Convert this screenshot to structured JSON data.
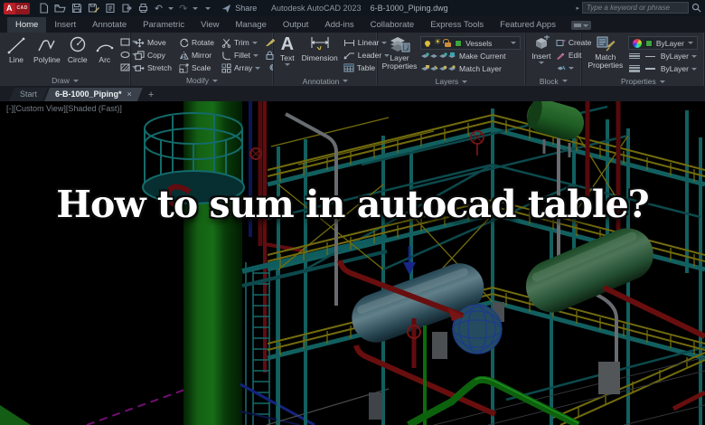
{
  "titlebar": {
    "logo_a": "A",
    "logo_cad": "CAD",
    "share_label": "Share",
    "app_title": "Autodesk AutoCAD 2023",
    "doc_title": "6-B-1000_Piping.dwg",
    "search_placeholder": "Type a keyword or phrase"
  },
  "ribbon_tabs": [
    "Home",
    "Insert",
    "Annotate",
    "Parametric",
    "View",
    "Manage",
    "Output",
    "Add-ins",
    "Collaborate",
    "Express Tools",
    "Featured Apps"
  ],
  "panels": {
    "draw": {
      "label": "Draw",
      "line": "Line",
      "polyline": "Polyline",
      "circle": "Circle",
      "arc": "Arc"
    },
    "modify": {
      "label": "Modify",
      "move": "Move",
      "rotate": "Rotate",
      "trim": "Trim",
      "copy": "Copy",
      "mirror": "Mirror",
      "fillet": "Fillet",
      "stretch": "Stretch",
      "scale": "Scale",
      "array": "Array"
    },
    "annotation": {
      "label": "Annotation",
      "text": "Text",
      "dimension": "Dimension",
      "linear": "Linear",
      "leader": "Leader",
      "table": "Table"
    },
    "layers": {
      "label": "Layers",
      "layer_properties": "Layer Properties",
      "current_layer": "Vessels",
      "make_current": "Make Current",
      "match_layer": "Match Layer"
    },
    "block": {
      "label": "Block",
      "insert": "Insert",
      "create": "Create",
      "edit": "Edit"
    },
    "properties": {
      "label": "Properties",
      "match_properties": "Match Properties",
      "color": "ByLayer",
      "linetype": "ByLayer",
      "lineweight": "ByLayer"
    }
  },
  "file_tabs": {
    "start": "Start",
    "document": "6-B-1000_Piping*",
    "close": "×",
    "new_tab": "+"
  },
  "viewport": {
    "controls": "[-][Custom View][Shaded (Fast)]",
    "overlay_title": "How to sum in autocad table?"
  },
  "colors": {
    "structure_teal": "#1b8c8c",
    "railing_yellow": "#a89f14",
    "pipe_red": "#8f1318",
    "vessel_green": "#2e8b2e",
    "layer_swatch_green": "#3da53d",
    "badge_red": "#b61f27"
  }
}
